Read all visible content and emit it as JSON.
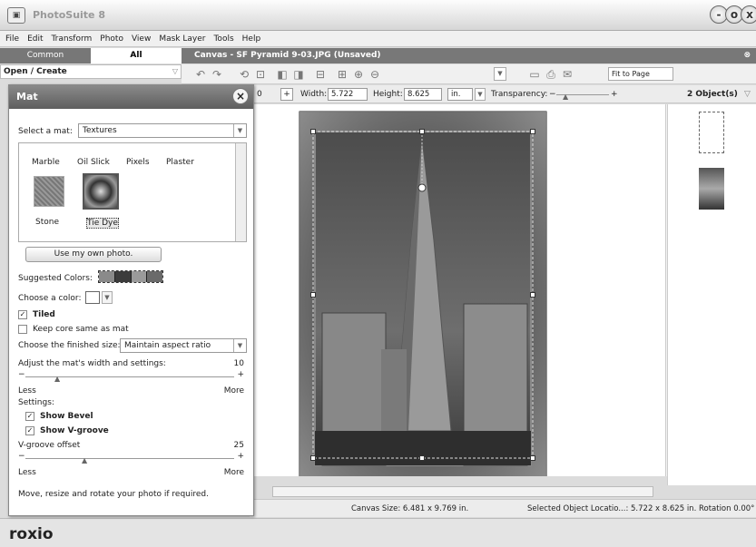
{
  "app": {
    "title": "PhotoSuite 8",
    "logo": "roxio",
    "icon": "app-icon"
  },
  "window_controls": [
    "-",
    "o",
    "x"
  ],
  "menu": [
    "File",
    "Edit",
    "Transform",
    "Photo",
    "View",
    "Mask Layer",
    "Tools",
    "Help"
  ],
  "left_tabs": [
    "Common",
    "All"
  ],
  "open_create": "Open / Create",
  "canvas_header": "Canvas - SF Pyramid 9-03.JPG (Unsaved)",
  "toolbar": {
    "fit_option": "Fit to Page"
  },
  "dims": {
    "width_label": "Width:",
    "width_value": "5.722",
    "height_label": "Height:",
    "height_value": "8.625",
    "units": "in.",
    "transparency_label": "Transparency:",
    "minus": "−",
    "plus": "+",
    "zoom_minus": "0",
    "zoom_plus": "+"
  },
  "objects_label": "2 Object(s)",
  "status": {
    "canvas_size": "Canvas Size: 6.481 x 9.769 in.",
    "selected": "Selected Object Locatio...: 5.722 x 8.625 in. Rotation 0.00°"
  },
  "mat_panel": {
    "title": "Mat",
    "close": "×",
    "select_label": "Select a mat:",
    "select_value": "Textures",
    "mats_row1": [
      "Marble",
      "Oil Slick",
      "Pixels",
      "Plaster"
    ],
    "mats_row2": [
      "Stone",
      "Tie Dye"
    ],
    "selected_mat": "Tie Dye",
    "own_photo_button": "Use my own photo.",
    "suggested_colors_label": "Suggested Colors:",
    "suggested_colors": [
      "#8a8a8a",
      "#3c3c3c",
      "#9a9a9a",
      "#6a6a6a"
    ],
    "choose_color_label": "Choose a color:",
    "tiled_label": "Tiled",
    "tiled_checked": true,
    "keep_core_label": "Keep core same as mat",
    "keep_core_checked": false,
    "finished_size_label": "Choose the finished size:",
    "finished_size_value": "Maintain aspect ratio",
    "adjust_label": "Adjust the mat's width and settings:",
    "adjust_value": "10",
    "less": "Less",
    "more": "More",
    "minus": "−",
    "plus": "+",
    "settings_label": "Settings:",
    "show_bevel_label": "Show Bevel",
    "show_bevel_checked": true,
    "show_vgroove_label": "Show V-groove",
    "show_vgroove_checked": true,
    "vgroove_offset_label": "V-groove offset",
    "vgroove_offset_value": "25",
    "instruction": "Move, resize and rotate your photo if required."
  }
}
